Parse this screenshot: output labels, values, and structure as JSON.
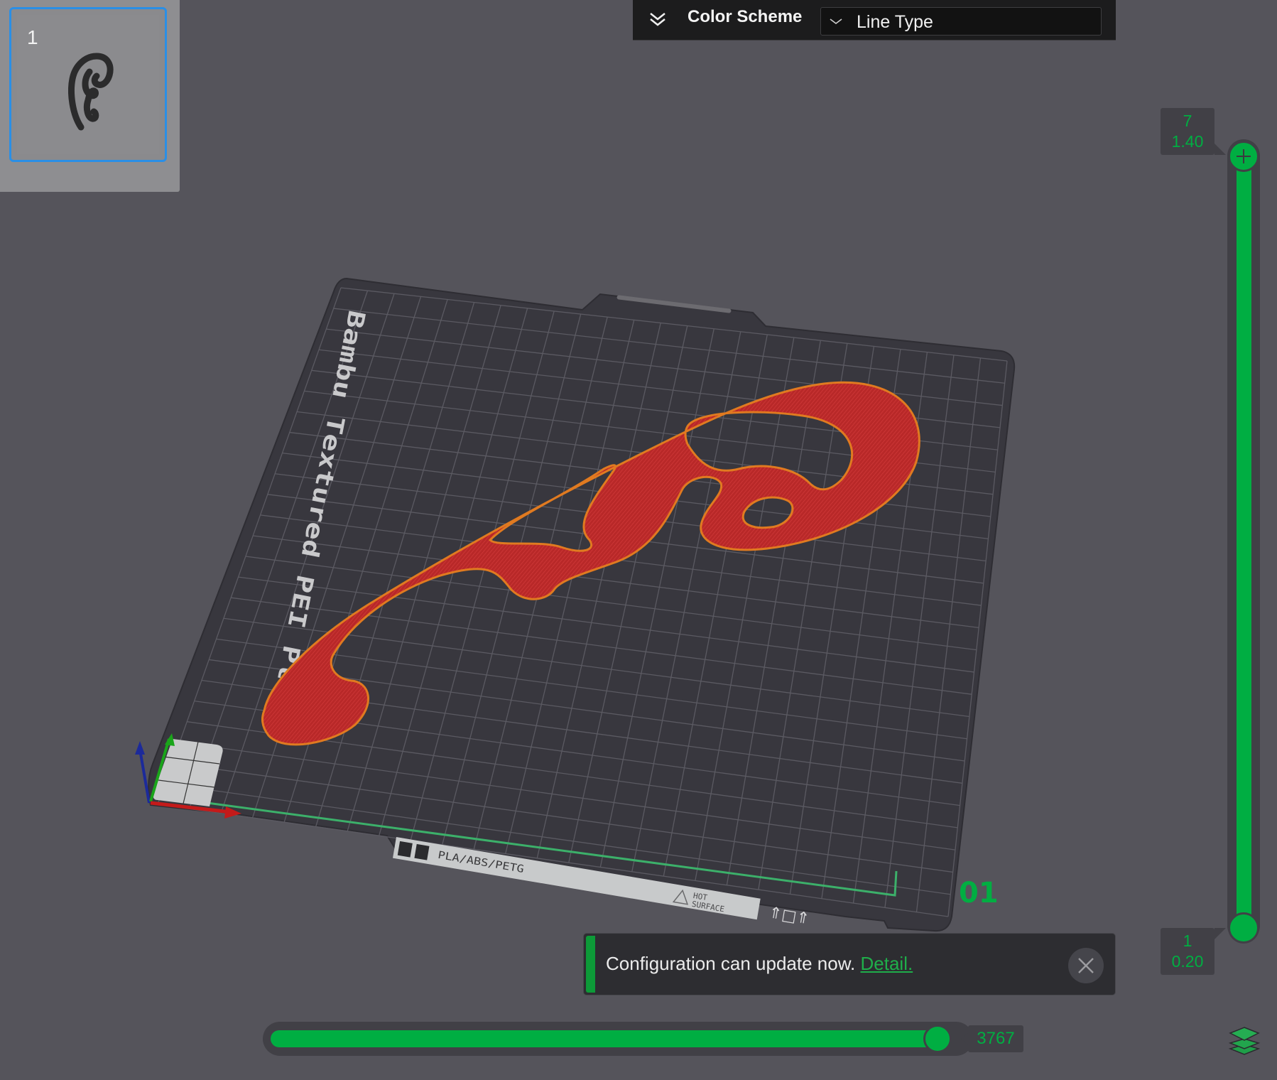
{
  "plates": {
    "items": [
      {
        "index": "1",
        "selected": true
      }
    ]
  },
  "toolbar": {
    "collapse_icon": "double-chevron-down-icon",
    "color_scheme_label": "Color Scheme",
    "color_scheme_value": "Line Type",
    "dropdown_icon": "chevron-down-icon"
  },
  "layer_slider": {
    "top": {
      "layer": "7",
      "height": "1.40"
    },
    "bottom": {
      "layer": "1",
      "height": "0.20"
    },
    "top_icon": "plus-icon",
    "range_fraction": [
      0,
      1
    ]
  },
  "move_slider": {
    "value": "3767",
    "fill_fraction": 1.0
  },
  "notification": {
    "message": "Configuration can update now.",
    "link": "Detail.",
    "close_icon": "close-icon"
  },
  "viewport": {
    "plate_label": "Bambu Textured PEI Plate",
    "plate_material": "PLA/ABS/PETG",
    "hot_surface_line1": "HOT",
    "hot_surface_line2": "SURFACE",
    "plate_number": "01",
    "model_color": "#c02a2a",
    "outline_color": "#e07a20",
    "accent": "#00ae42"
  },
  "layers_icon": "layers-icon"
}
